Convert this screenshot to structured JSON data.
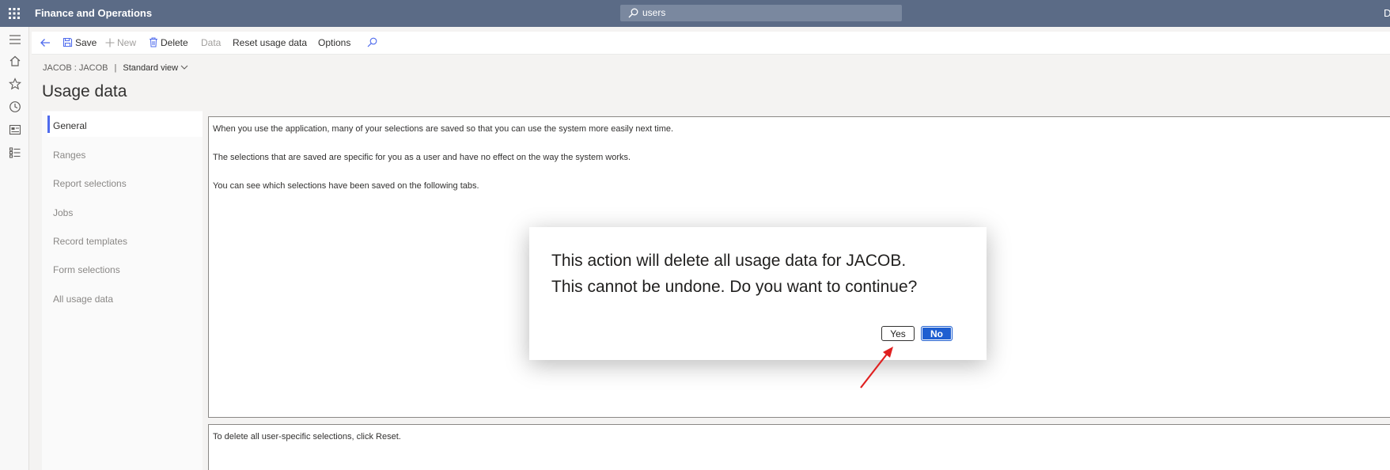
{
  "topbar": {
    "app_title": "Finance and Operations",
    "search_value": "users",
    "user_initial": "D"
  },
  "action_pane": {
    "save": "Save",
    "new": "New",
    "delete": "Delete",
    "data": "Data",
    "reset_usage_data": "Reset usage data",
    "options": "Options"
  },
  "breadcrumb": {
    "company": "JACOB : JACOB",
    "separator": "|",
    "view": "Standard view"
  },
  "page": {
    "title": "Usage data"
  },
  "tabs": [
    {
      "label": "General"
    },
    {
      "label": "Ranges"
    },
    {
      "label": "Report selections"
    },
    {
      "label": "Jobs"
    },
    {
      "label": "Record templates"
    },
    {
      "label": "Form selections"
    },
    {
      "label": "All usage data"
    }
  ],
  "general": {
    "line1": "When you use the application, many of your selections are saved so that you can use the system more easily next time.",
    "line2": "The selections that are saved are specific for you as a user and have no effect on the way the system works.",
    "line3": "You can see which selections have been saved on the following tabs."
  },
  "reset_section": {
    "text": "To delete all user-specific selections, click Reset."
  },
  "dialog": {
    "line1": "This action will delete all usage data for JACOB.",
    "line2": "This cannot be undone. Do you want to continue?",
    "yes": "Yes",
    "no": "No"
  },
  "colors": {
    "topbar": "#5b6b86",
    "accent": "#4f6bed",
    "primary_button": "#1f5fd1",
    "annotation_arrow": "#e02020"
  }
}
